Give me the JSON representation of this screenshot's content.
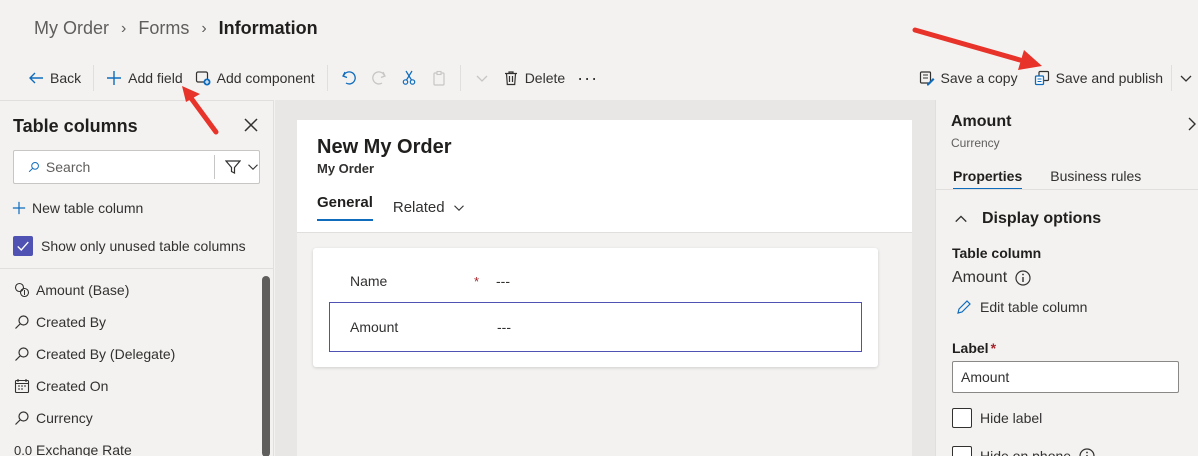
{
  "breadcrumb": {
    "items": [
      "My Order",
      "Forms"
    ],
    "current": "Information"
  },
  "toolbar": {
    "back": "Back",
    "add_field": "Add field",
    "add_component": "Add component",
    "delete": "Delete",
    "more": "···",
    "save_copy": "Save a copy",
    "save_publish": "Save and publish"
  },
  "left_panel": {
    "title": "Table columns",
    "search_placeholder": "Search",
    "new_column": "New table column",
    "show_unused": "Show only unused table columns",
    "columns": [
      {
        "label": "Amount (Base)",
        "icon": "currency-icon"
      },
      {
        "label": "Created By",
        "icon": "lookup-icon"
      },
      {
        "label": "Created By (Delegate)",
        "icon": "lookup-icon"
      },
      {
        "label": "Created On",
        "icon": "calendar-icon"
      },
      {
        "label": "Currency",
        "icon": "lookup-icon"
      },
      {
        "label": "Exchange Rate",
        "icon": "decimal-icon",
        "icon_text": "0.0"
      }
    ]
  },
  "form": {
    "title": "New My Order",
    "subtitle": "My Order",
    "tabs": {
      "general": "General",
      "related": "Related"
    },
    "fields": [
      {
        "label": "Name",
        "required": "*",
        "value": "---"
      },
      {
        "label": "Amount",
        "value": "---"
      }
    ]
  },
  "right_panel": {
    "title": "Amount",
    "subtitle": "Currency",
    "tabs": {
      "properties": "Properties",
      "business_rules": "Business rules"
    },
    "section": "Display options",
    "table_column_label": "Table column",
    "table_column_value": "Amount",
    "edit_column": "Edit table column",
    "label_label": "Label",
    "label_required": "*",
    "label_value": "Amount",
    "hide_label": "Hide label",
    "hide_on_phone": "Hide on phone"
  },
  "colors": {
    "accent": "#4f52b2",
    "tab_underline": "#0f6cbd",
    "annotation_arrow": "#e8332a"
  }
}
